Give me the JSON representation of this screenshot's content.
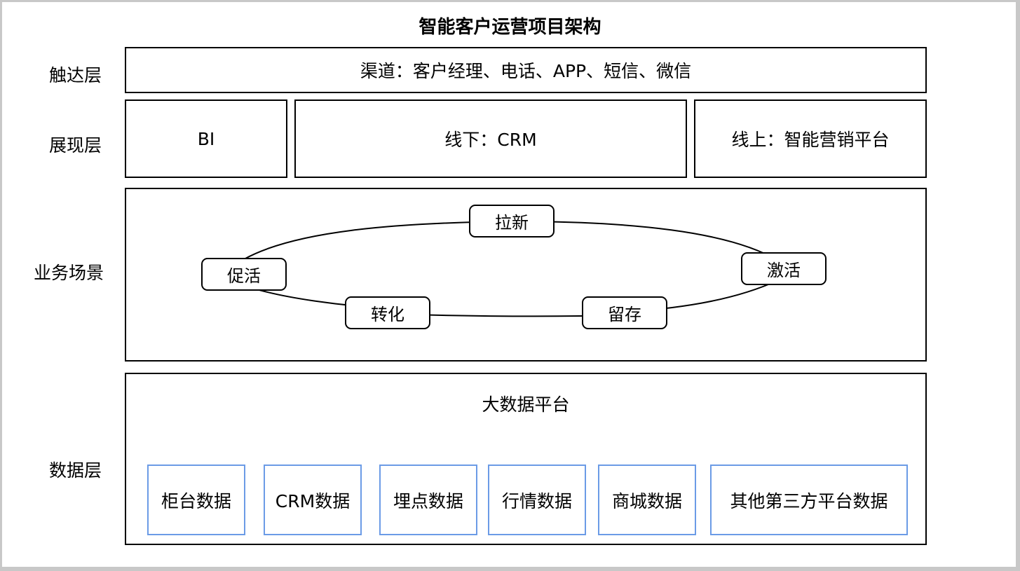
{
  "title": "智能客户运营项目架构",
  "layers": {
    "reach": {
      "label": "触达层",
      "content": "渠道：客户经理、电话、APP、短信、微信"
    },
    "presentation": {
      "label": "展现层",
      "boxes": [
        "BI",
        "线下：CRM",
        "线上：智能营销平台"
      ]
    },
    "business": {
      "label": "业务场景",
      "nodes": [
        "拉新",
        "激活",
        "留存",
        "转化",
        "促活"
      ]
    },
    "data": {
      "label": "数据层",
      "platform": "大数据平台",
      "sources": [
        "柜台数据",
        "CRM数据",
        "埋点数据",
        "行情数据",
        "商城数据",
        "其他第三方平台数据"
      ]
    }
  },
  "colors": {
    "data_box_border": "#6b9be6",
    "line": "#000000"
  }
}
